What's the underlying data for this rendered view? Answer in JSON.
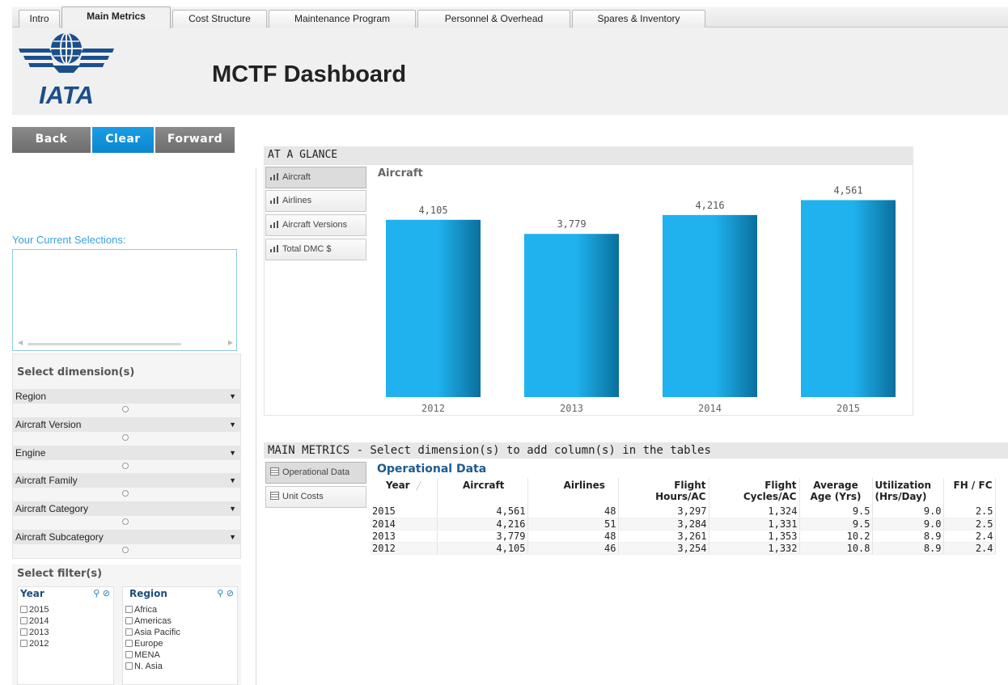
{
  "tabs": [
    {
      "label": "Intro",
      "active": false
    },
    {
      "label": "Main Metrics",
      "active": true
    },
    {
      "label": "Cost Structure",
      "active": false
    },
    {
      "label": "Maintenance Program",
      "active": false
    },
    {
      "label": "Personnel & Overhead",
      "active": false
    },
    {
      "label": "Spares & Inventory",
      "active": false
    }
  ],
  "header": {
    "title": "MCTF Dashboard",
    "logo_text": "IATA"
  },
  "nav": {
    "back": "Back",
    "clear": "Clear",
    "forward": "Forward"
  },
  "current_selections": {
    "label": "Your Current Selections:"
  },
  "dimensions": {
    "title": "Select dimension(s)",
    "items": [
      "Region",
      "Aircraft Version",
      "Engine",
      "Aircraft Family",
      "Aircraft Category",
      "Aircraft Subcategory"
    ]
  },
  "filters": {
    "title": "Select filter(s)",
    "year": {
      "title": "Year",
      "items": [
        "2015",
        "2014",
        "2013",
        "2012"
      ]
    },
    "region": {
      "title": "Region",
      "items": [
        "Africa",
        "Americas",
        "Asia Pacific",
        "Europe",
        "MENA",
        "N. Asia"
      ]
    }
  },
  "at_a_glance": {
    "title": "AT A GLANCE",
    "buttons": [
      "Aircraft",
      "Airlines",
      "Aircraft Versions",
      "Total DMC $"
    ],
    "selected": "Aircraft"
  },
  "chart_data": {
    "type": "bar",
    "title": "Aircraft",
    "categories": [
      "2012",
      "2013",
      "2014",
      "2015"
    ],
    "values": [
      4105,
      3779,
      4216,
      4561
    ],
    "value_labels": [
      "4,105",
      "3,779",
      "4,216",
      "4,561"
    ],
    "xlabel": "",
    "ylabel": "",
    "ylim": [
      0,
      5000
    ],
    "grid": false,
    "colors": {
      "bar_light": "#1fb2ee",
      "bar_dark": "#0a6f9d"
    }
  },
  "main_metrics": {
    "title": "MAIN METRICS - Select dimension(s) to add column(s) in the tables",
    "buttons": [
      "Operational Data",
      "Unit Costs"
    ],
    "table_title": "Operational Data",
    "columns": [
      "Year",
      "Aircraft",
      "Airlines",
      "Flight Hours/AC",
      "Flight Cycles/AC",
      "Average Age (Yrs)",
      "Utilization (Hrs/Day)",
      "FH / FC"
    ],
    "rows": [
      [
        "2015",
        "4,561",
        "48",
        "3,297",
        "1,324",
        "9.5",
        "9.0",
        "2.5"
      ],
      [
        "2014",
        "4,216",
        "51",
        "3,284",
        "1,331",
        "9.5",
        "9.0",
        "2.5"
      ],
      [
        "2013",
        "3,779",
        "48",
        "3,261",
        "1,353",
        "10.2",
        "8.9",
        "2.4"
      ],
      [
        "2012",
        "4,105",
        "46",
        "3,254",
        "1,332",
        "10.8",
        "8.9",
        "2.4"
      ]
    ]
  },
  "colors": {
    "accent": "#0a86cf",
    "header_bg": "#f0f0f0",
    "logo_blue": "#1b4f8c"
  }
}
